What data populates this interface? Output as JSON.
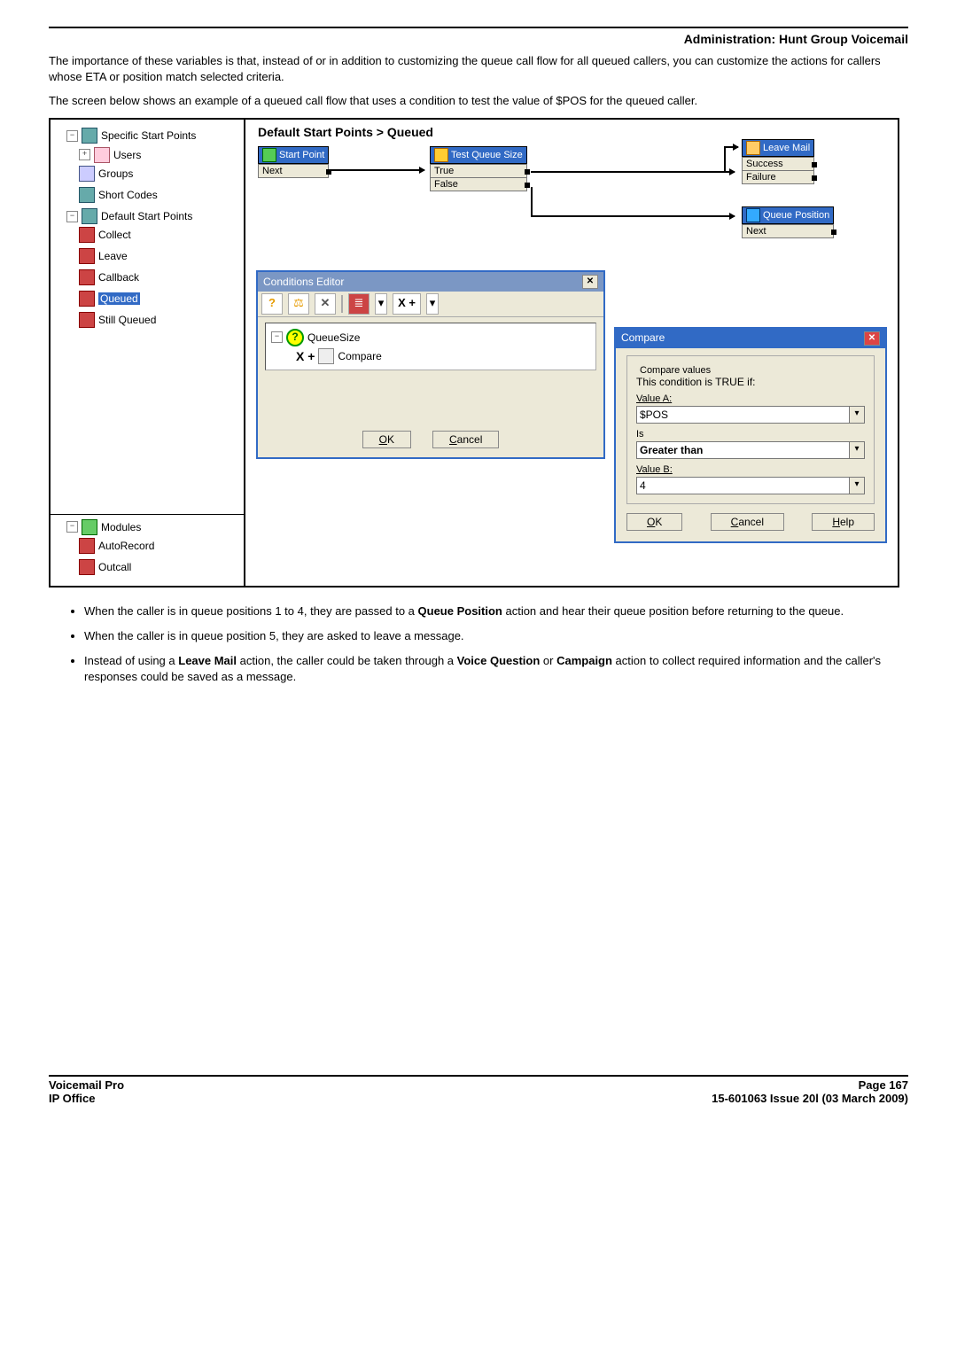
{
  "header": {
    "title": "Administration: Hunt Group Voicemail"
  },
  "intro1": "The importance of these variables is that, instead of or in addition to customizing the queue call flow for all queued callers, you can customize the actions for callers whose ETA or position match selected criteria.",
  "intro2": "The screen below shows an example of a queued call flow that uses a condition to test the value of $POS for the queued caller.",
  "tree": {
    "specific": "Specific Start Points",
    "users": "Users",
    "groups": "Groups",
    "shortcodes": "Short Codes",
    "default": "Default Start Points",
    "collect": "Collect",
    "leave": "Leave",
    "callback": "Callback",
    "queued": "Queued",
    "stillqueued": "Still Queued",
    "modules": "Modules",
    "autorecord": "AutoRecord",
    "outcall": "Outcall"
  },
  "canvas": {
    "breadcrumb": "Default Start Points > Queued",
    "start": {
      "title": "Start Point",
      "out": "Next"
    },
    "test": {
      "title": "Test Queue Size",
      "out_true": "True",
      "out_false": "False"
    },
    "leave": {
      "title": "Leave Mail",
      "out_s": "Success",
      "out_f": "Failure"
    },
    "qpos": {
      "title": "Queue Position",
      "out": "Next"
    }
  },
  "cond": {
    "title": "Conditions Editor",
    "tb": {
      "b1": "?",
      "b2": "⚖",
      "b3": "✕",
      "b4": "≣",
      "b5": "▾",
      "b6": "X +",
      "b7": "▾"
    },
    "node1": "QueueSize",
    "node2_prefix": "X +",
    "node2": "Compare",
    "ok": "OK",
    "cancel": "Cancel"
  },
  "cmp": {
    "title": "Compare",
    "legend": "Compare values",
    "cond_text": "This condition is TRUE if:",
    "valA_label": "Value A:",
    "valA": "$POS",
    "is_label": "Is",
    "is_val": "Greater than",
    "valB_label": "Value B:",
    "valB": "4",
    "ok": "OK",
    "cancel": "Cancel",
    "help": "Help"
  },
  "bullets": {
    "b1a": "When the caller is in queue positions 1 to 4, they are passed to a ",
    "b1b": "Queue Position",
    "b1c": " action and hear their queue position before returning to the queue.",
    "b2": "When the caller is in queue position 5, they are asked to leave a message.",
    "b3a": "Instead of using a ",
    "b3b": "Leave Mail",
    "b3c": " action, the caller could be taken through a ",
    "b3d": "Voice Question",
    "b3e": " or ",
    "b3f": "Campaign",
    "b3g": " action to collect required information and the caller's responses could be saved as a message."
  },
  "footer": {
    "l1": "Voicemail Pro",
    "l2": "IP Office",
    "r1": "Page 167",
    "r2": "15-601063 Issue 20l (03 March 2009)"
  }
}
